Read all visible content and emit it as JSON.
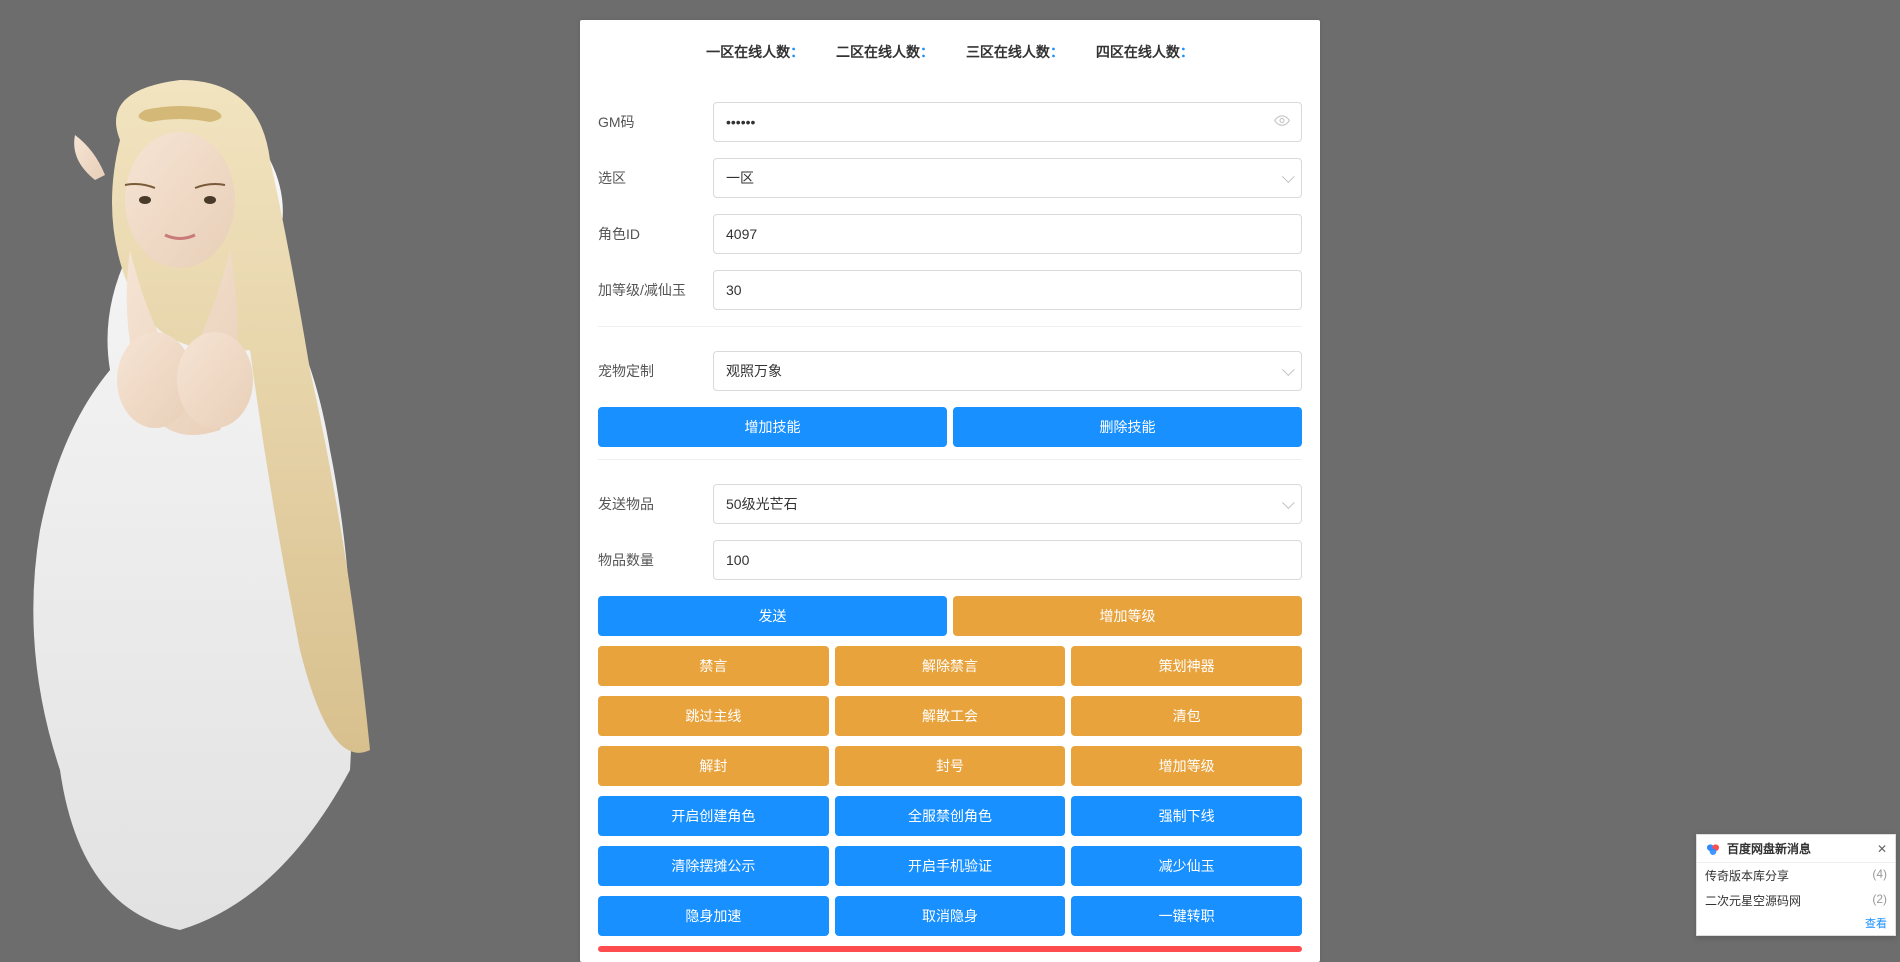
{
  "header": {
    "zone1": "一区在线人数",
    "zone2": "二区在线人数",
    "zone3": "三区在线人数",
    "zone4": "四区在线人数",
    "colon": "："
  },
  "form": {
    "gm_code_label": "GM码",
    "gm_code_value": "••••••",
    "zone_label": "选区",
    "zone_value": "一区",
    "role_id_label": "角色ID",
    "role_id_value": "4097",
    "level_label": "加等级/减仙玉",
    "level_value": "30",
    "pet_label": "宠物定制",
    "pet_value": "观照万象",
    "item_label": "发送物品",
    "item_value": "50级光芒石",
    "qty_label": "物品数量",
    "qty_value": "100"
  },
  "skill_buttons": {
    "add": "增加技能",
    "del": "删除技能"
  },
  "action_row1": {
    "send": "发送",
    "add_level": "增加等级"
  },
  "action_row2": {
    "mute": "禁言",
    "unmute": "解除禁言",
    "plan_artifact": "策划神器"
  },
  "action_row3": {
    "skip_main": "跳过主线",
    "disband_guild": "解散工会",
    "clear_bag": "清包"
  },
  "action_row4": {
    "unseal": "解封",
    "seal": "封号",
    "add_level2": "增加等级"
  },
  "action_row5": {
    "enable_create": "开启创建角色",
    "ban_create": "全服禁创角色",
    "force_offline": "强制下线"
  },
  "action_row6": {
    "clear_stall": "清除摆摊公示",
    "enable_phone": "开启手机验证",
    "reduce_jade": "减少仙玉"
  },
  "action_row7": {
    "stealth_speed": "隐身加速",
    "cancel_stealth": "取消隐身",
    "one_key_transfer": "一键转职"
  },
  "notify": {
    "title": "百度网盘新消息",
    "item1": "传奇版本库分享",
    "count1": "(4)",
    "item2": "二次元星空源码网",
    "count2": "(2)",
    "more": "查看"
  }
}
